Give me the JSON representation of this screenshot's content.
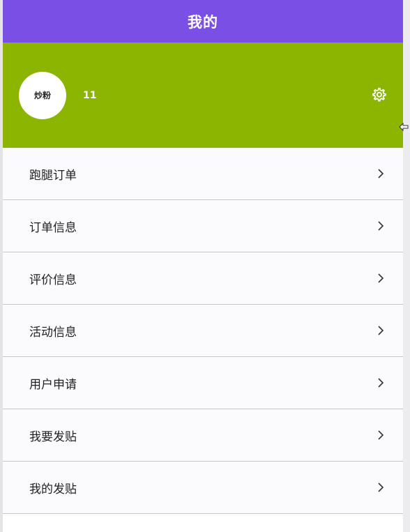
{
  "header": {
    "title": "我的"
  },
  "profile": {
    "avatar_text": "炒粉",
    "user_name": "11",
    "settings_icon": "gear-icon"
  },
  "menu": {
    "items": [
      {
        "label": "跑腿订单",
        "icon": "chevron-right-icon"
      },
      {
        "label": "订单信息",
        "icon": "chevron-right-icon"
      },
      {
        "label": "评价信息",
        "icon": "chevron-right-icon"
      },
      {
        "label": "活动信息",
        "icon": "chevron-right-icon"
      },
      {
        "label": "用户申请",
        "icon": "chevron-right-icon"
      },
      {
        "label": "我要发贴",
        "icon": "chevron-right-icon"
      },
      {
        "label": "我的发贴",
        "icon": "chevron-right-icon"
      }
    ]
  },
  "colors": {
    "header_bg": "#7a4fe6",
    "profile_bg": "#8bb500",
    "page_bg": "#ffffff",
    "divider": "#c6c6cc",
    "text": "#222222"
  }
}
